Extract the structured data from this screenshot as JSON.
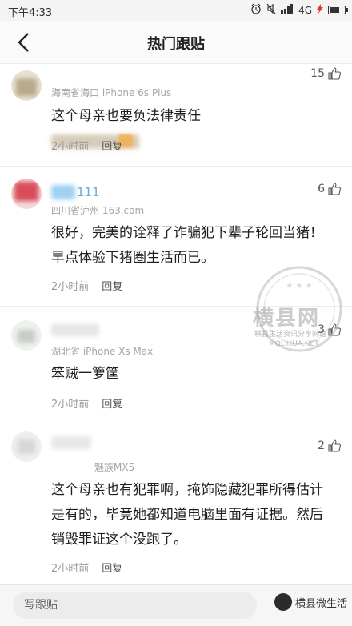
{
  "status_bar": {
    "time": "下午4:33",
    "network": "4G"
  },
  "nav": {
    "title": "热门跟贴"
  },
  "comments": [
    {
      "meta": "海南省海口 iPhone 6s Plus",
      "likes": "15",
      "text": "这个母亲也要负法律责任",
      "time": "2小时前",
      "reply": "回复"
    },
    {
      "username": "111",
      "meta": "四川省泸州 163.com",
      "likes": "6",
      "text": "很好，完美的诠释了诈骗犯下辈子轮回当猪！早点体验下猪圈生活而已。",
      "time": "2小时前",
      "reply": "回复"
    },
    {
      "meta": "湖北省 iPhone Xs Max",
      "likes": "3",
      "text": "笨贼一箩筐",
      "time": "2小时前",
      "reply": "回复"
    },
    {
      "meta": "魅族MX5",
      "likes": "2",
      "text": "这个母亲也有犯罪啊，掩饰隐藏犯罪所得估计是有的，毕竟她都知道电脑里面有证据。然后销毁罪证这个没跑了。",
      "time": "2小时前",
      "reply": "回复"
    }
  ],
  "write_bar": {
    "placeholder": "写跟贴",
    "badge": "横县微生活"
  },
  "watermark": {
    "main": "横县网",
    "sub": "横县生活资讯分享网站",
    "url": "MOLIHUA.NET"
  }
}
